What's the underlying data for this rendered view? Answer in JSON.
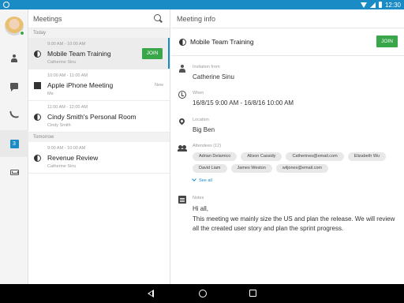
{
  "status_bar": {
    "time": "12:30"
  },
  "rail": {
    "calendar_day": "3"
  },
  "list": {
    "title": "Meetings",
    "sections": [
      {
        "label": "Today",
        "items": [
          {
            "time": "9:00 AM - 10:00 AM",
            "title": "Mobile Team Training",
            "subtitle": "Catherine Sinu",
            "action": "JOIN",
            "icon": "half-circle-icon"
          },
          {
            "time": "10:00 AM - 11:00 AM",
            "title": "Apple iPhone Meeting",
            "subtitle": "Me",
            "tag": "New",
            "icon": "edit-icon"
          },
          {
            "time": "11:00 AM - 12:00 AM",
            "title": "Cindy Smith's Personal Room",
            "subtitle": "Cindy Smith",
            "icon": "half-circle-icon"
          }
        ]
      },
      {
        "label": "Tomorrow",
        "items": [
          {
            "time": "9:00 AM - 10:00 AM",
            "title": "Revenue Review",
            "subtitle": "Catherine Sinu",
            "icon": "half-circle-icon"
          }
        ]
      }
    ]
  },
  "detail": {
    "header": "Meeting info",
    "title": "Mobile Team Training",
    "join_label": "JOIN",
    "invitation_label": "Invitation from",
    "invitation_value": "Catherine Sinu",
    "when_label": "When",
    "when_value": "16/8/15 9:00 AM - 16/8/16 10:00 AM",
    "location_label": "Location",
    "location_value": "Big Ben",
    "attendees_label": "Attendees (12)",
    "attendees": [
      "Adrian Delamico",
      "Alison Cassidy",
      "Catherines@email.com",
      "Elizabeth Wu",
      "David Liam",
      "James Weston",
      "wiljones@email.com"
    ],
    "see_all": "See all",
    "notes_label": "Notes",
    "notes_line1": "Hi all,",
    "notes_line2": "This meeting we mainly size the US and plan the release. We will review all the created user story and plan the sprint progress."
  },
  "colors": {
    "accent": "#1a8bc4",
    "join": "#3aa64a"
  }
}
